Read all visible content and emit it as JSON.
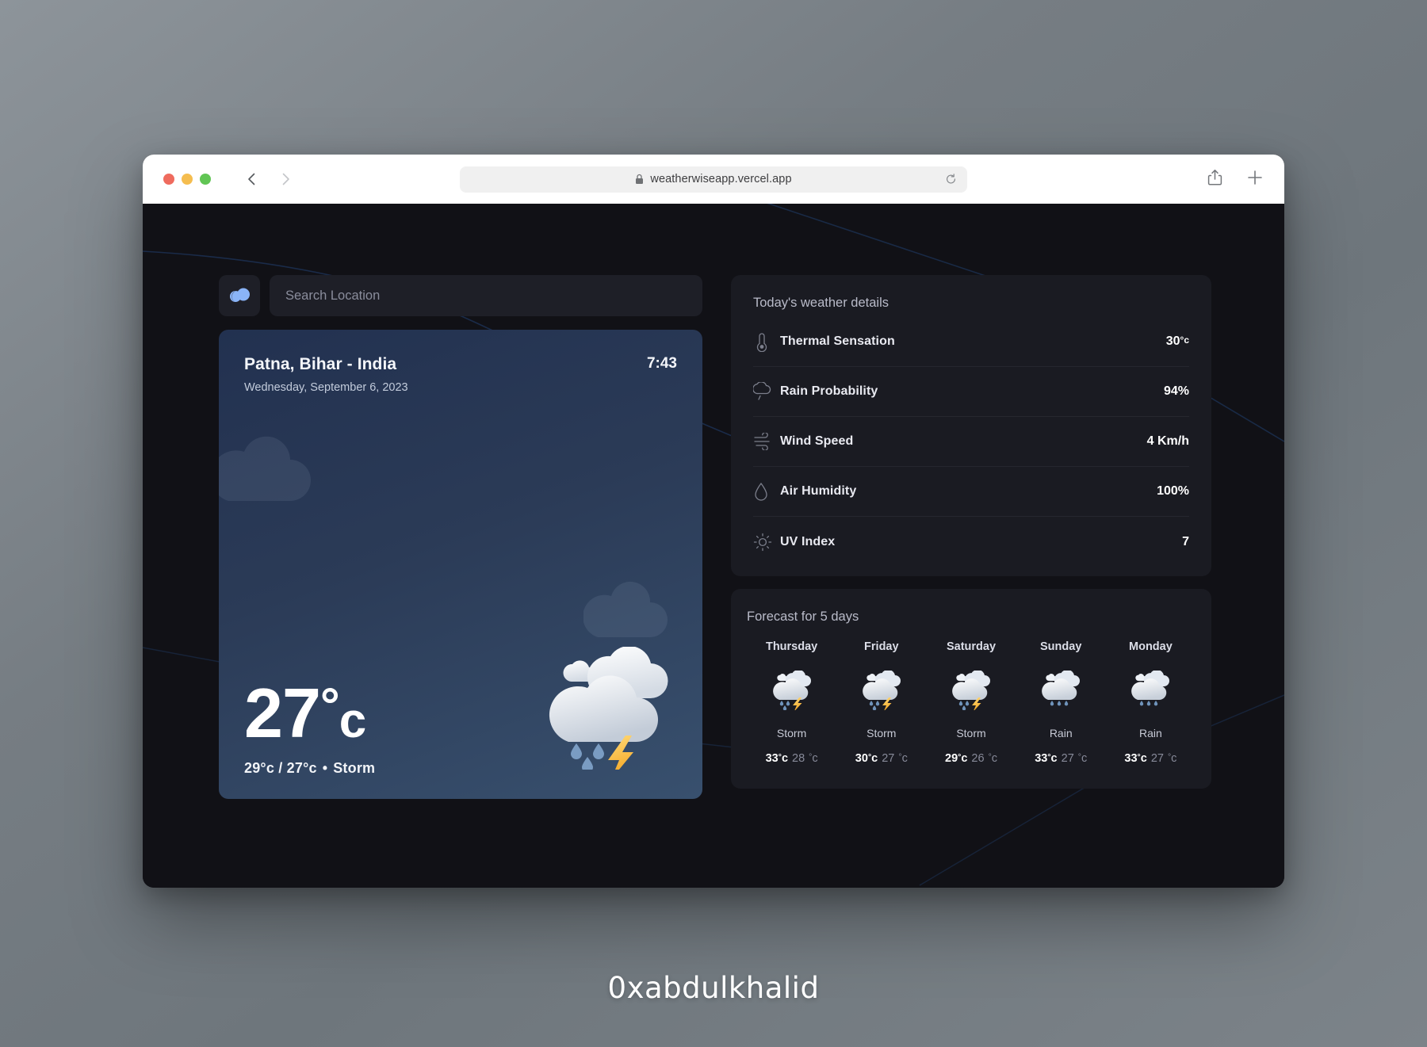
{
  "browser": {
    "url": "weatherwiseapp.vercel.app",
    "lock_icon": "lock-icon",
    "reload_icon": "reload-icon",
    "back_icon": "chevron-left-icon",
    "forward_icon": "chevron-right-icon",
    "share_icon": "share-icon",
    "new_tab_icon": "plus-icon"
  },
  "app": {
    "logo_icon": "cloud-logo-icon",
    "search": {
      "placeholder": "Search Location",
      "value": ""
    },
    "current": {
      "location": "Patna, Bihar - India",
      "time": "7:43",
      "date": "Wednesday, September 6, 2023",
      "temperature": "27",
      "degree": "°",
      "unit": "c",
      "high": "29",
      "low": "27",
      "separator": "/",
      "bullet": "•",
      "condition": "Storm",
      "icon": "storm-cloud-rain-lightning-icon"
    },
    "details": {
      "title": "Today's weather details",
      "rows": [
        {
          "icon": "thermometer-icon",
          "label": "Thermal Sensation",
          "value": "30",
          "suffix": "°c"
        },
        {
          "icon": "rain-cloud-icon",
          "label": "Rain Probability",
          "value": "94%",
          "suffix": ""
        },
        {
          "icon": "wind-icon",
          "label": "Wind Speed",
          "value": "4 Km/h",
          "suffix": ""
        },
        {
          "icon": "humidity-droplet-icon",
          "label": "Air Humidity",
          "value": "100%",
          "suffix": ""
        },
        {
          "icon": "sun-uv-icon",
          "label": "UV Index",
          "value": "7",
          "suffix": ""
        }
      ]
    },
    "forecast": {
      "title": "Forecast for 5 days",
      "days": [
        {
          "name": "Thursday",
          "icon": "storm-icon",
          "condition": "Storm",
          "high": "33",
          "low": "28"
        },
        {
          "name": "Friday",
          "icon": "storm-icon",
          "condition": "Storm",
          "high": "30",
          "low": "27"
        },
        {
          "name": "Saturday",
          "icon": "storm-icon",
          "condition": "Storm",
          "high": "29",
          "low": "26"
        },
        {
          "name": "Sunday",
          "icon": "rain-icon",
          "condition": "Rain",
          "high": "33",
          "low": "27"
        },
        {
          "name": "Monday",
          "icon": "rain-icon",
          "condition": "Rain",
          "high": "33",
          "low": "27"
        }
      ]
    }
  },
  "watermark": "0xabdulkhalid",
  "colors": {
    "app_bg": "#111116",
    "panel_bg": "#1a1b22",
    "input_bg": "#1e1f27",
    "card_gradient_from": "#223150",
    "card_gradient_to": "#38506e",
    "accent_blue": "#8ab4f8",
    "lightning_yellow": "#f7b731",
    "raindrop_blue": "#7a9cc2"
  }
}
